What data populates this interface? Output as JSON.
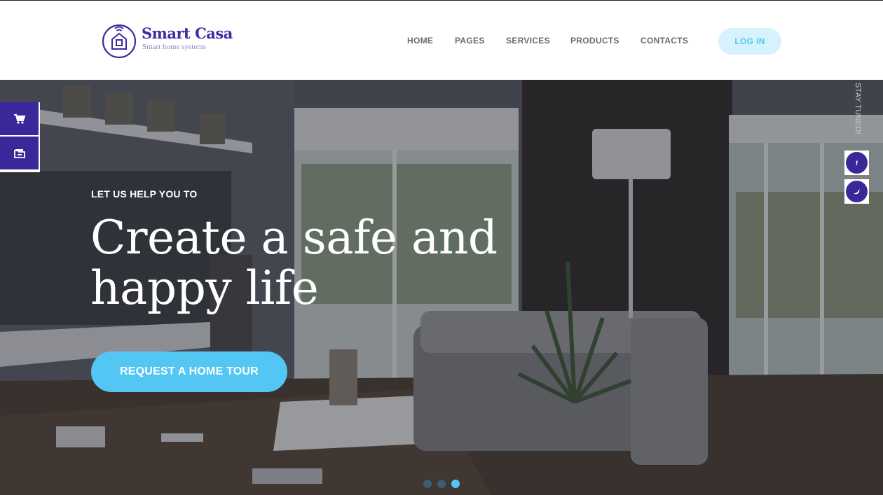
{
  "brand": {
    "name": "Smart Casa",
    "tagline": "Smart home systems"
  },
  "nav": {
    "items": [
      "HOME",
      "PAGES",
      "SERVICES",
      "PRODUCTS",
      "CONTACTS"
    ],
    "login_label": "LOG IN"
  },
  "hero": {
    "subtitle": "LET US HELP YOU TO",
    "title_line1": "Create a safe and",
    "title_line2": "happy life",
    "cta_label": "REQUEST A HOME TOUR",
    "slides": {
      "count": 3,
      "active": 3
    }
  },
  "side_tools": {
    "items": [
      {
        "icon": "cart-icon"
      },
      {
        "icon": "folder-icon"
      }
    ]
  },
  "social": {
    "label": "STAY TUNED!",
    "items": [
      {
        "icon": "facebook-icon",
        "glyph": "f"
      },
      {
        "icon": "twitter-icon",
        "glyph": "t"
      }
    ]
  },
  "colors": {
    "brand_purple": "#3f2aa3",
    "accent_blue": "#54c6f4",
    "login_bg": "#d6f3fd",
    "nav_text": "#666a72"
  }
}
